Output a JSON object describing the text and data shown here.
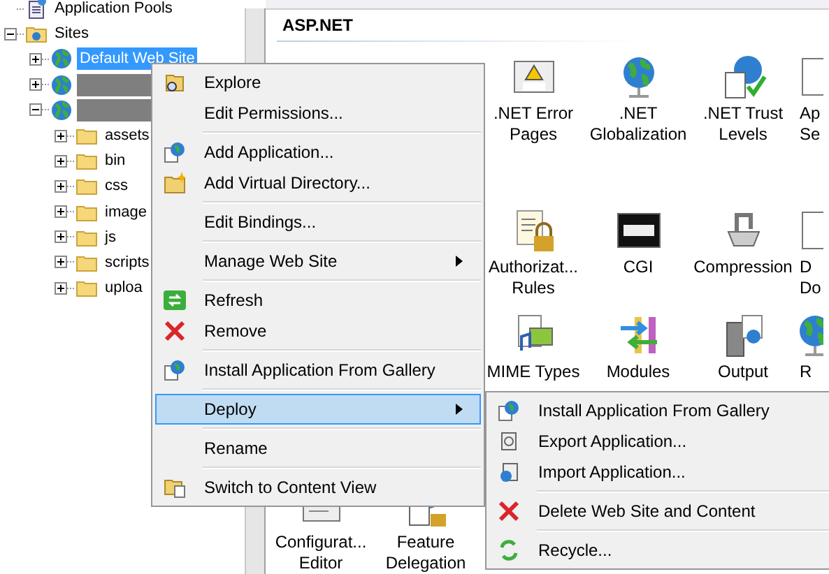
{
  "tree": [
    {
      "label": "Application Pools",
      "kind": "pools",
      "selected": false
    },
    {
      "label": "Sites",
      "kind": "sites",
      "expanded": true,
      "selected": false,
      "children": [
        {
          "label": "Default Web Site",
          "kind": "site",
          "expanded": false,
          "selected": true
        },
        {
          "kind": "site",
          "redacted": true,
          "expanded": false,
          "selected": false
        },
        {
          "kind": "site",
          "redacted": true,
          "expanded": true,
          "selected": false,
          "children": [
            {
              "label": "assets",
              "kind": "folder",
              "expanded": false,
              "selected": false
            },
            {
              "label": "bin",
              "kind": "folder",
              "expanded": false,
              "selected": false
            },
            {
              "label": "css",
              "kind": "folder",
              "expanded": false,
              "selected": false
            },
            {
              "label": "image",
              "kind": "folder",
              "expanded": false,
              "selected": false
            },
            {
              "label": "js",
              "kind": "folder",
              "expanded": false,
              "selected": false
            },
            {
              "label": "scripts",
              "kind": "folder",
              "expanded": false,
              "selected": false
            },
            {
              "label": "uploa",
              "kind": "folder",
              "expanded": false,
              "selected": false
            }
          ]
        }
      ]
    }
  ],
  "features": {
    "heading": "ASP.NET",
    "rows": [
      [
        {
          "lines": [
            ".NET Error",
            "Pages"
          ]
        },
        {
          "lines": [
            ".NET",
            "Globalization"
          ]
        },
        {
          "lines": [
            ".NET Trust",
            "Levels"
          ]
        },
        {
          "lines": [
            "Ap",
            "Se"
          ]
        }
      ],
      [
        {
          "lines": [
            "Authorizat...",
            "Rules"
          ]
        },
        {
          "lines": [
            "CGI"
          ]
        },
        {
          "lines": [
            "Compression"
          ]
        },
        {
          "lines": [
            "D",
            "Do"
          ]
        }
      ],
      [
        {
          "lines": [
            "MIME Types"
          ]
        },
        {
          "lines": [
            "Modules"
          ]
        },
        {
          "lines": [
            "Output"
          ]
        },
        {
          "lines": [
            "R"
          ]
        }
      ],
      [
        {
          "lines": [
            "Configurat...",
            "Editor"
          ]
        },
        {
          "lines": [
            "Feature",
            "Delegation"
          ]
        }
      ]
    ]
  },
  "context_menu": [
    {
      "label": "Explore",
      "selected": false
    },
    {
      "label": "Edit Permissions...",
      "selected": false
    },
    {
      "kind": "separator"
    },
    {
      "label": "Add Application...",
      "selected": false
    },
    {
      "label": "Add Virtual Directory...",
      "selected": false
    },
    {
      "kind": "separator"
    },
    {
      "label": "Edit Bindings...",
      "selected": false
    },
    {
      "kind": "separator"
    },
    {
      "label": "Manage Web Site",
      "submenu": true,
      "selected": false
    },
    {
      "kind": "separator"
    },
    {
      "label": "Refresh",
      "selected": false
    },
    {
      "label": "Remove",
      "selected": false
    },
    {
      "kind": "separator"
    },
    {
      "label": "Install Application From Gallery",
      "selected": false
    },
    {
      "kind": "separator"
    },
    {
      "label": "Deploy",
      "submenu": true,
      "selected": true
    },
    {
      "kind": "separator"
    },
    {
      "label": "Rename",
      "selected": false
    },
    {
      "kind": "separator"
    },
    {
      "label": "Switch to Content View",
      "selected": false
    }
  ],
  "submenu": [
    {
      "label": "Install Application From Gallery"
    },
    {
      "label": "Export Application..."
    },
    {
      "label": "Import Application..."
    },
    {
      "kind": "separator"
    },
    {
      "label": "Delete Web Site and Content"
    },
    {
      "kind": "separator"
    },
    {
      "label": "Recycle..."
    }
  ]
}
